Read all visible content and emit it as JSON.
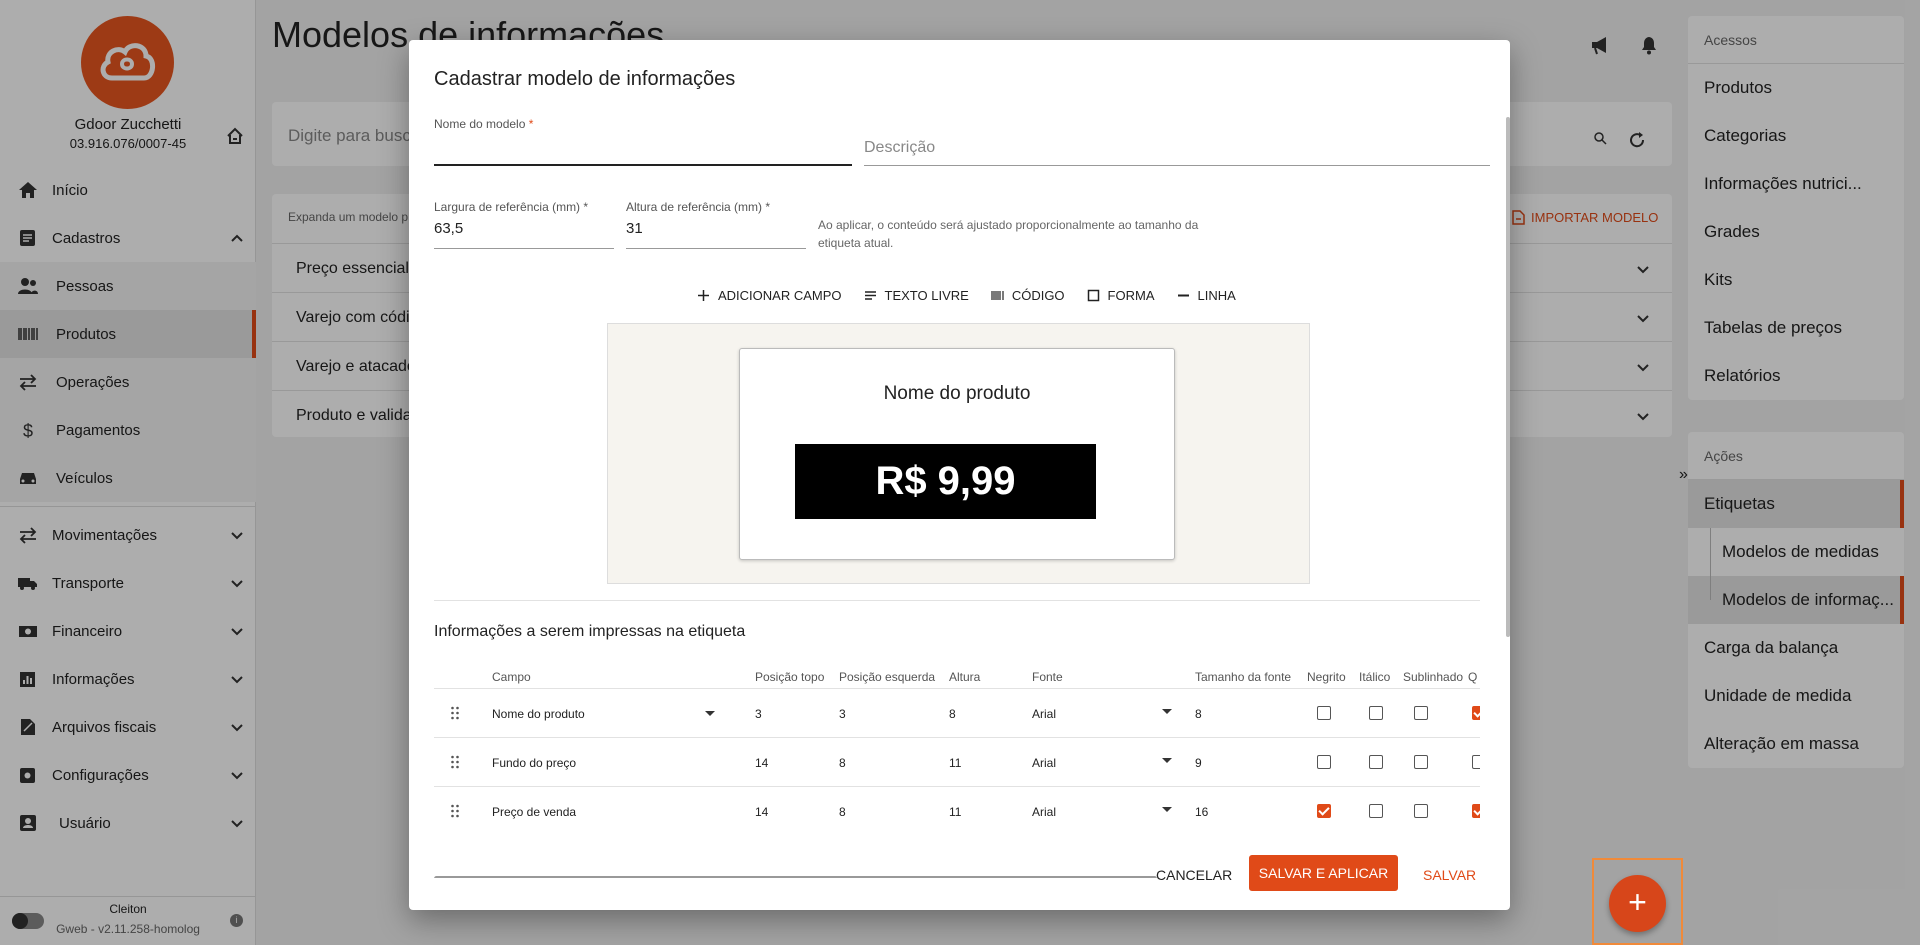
{
  "sidebar": {
    "user_name": "Gdoor Zucchetti",
    "user_cnpj": "03.916.076/0007-45",
    "items": [
      {
        "label": "Início",
        "icon": "home-icon"
      },
      {
        "label": "Cadastros",
        "icon": "document-icon",
        "expanded": true
      },
      {
        "label": "Pessoas",
        "icon": "people-icon"
      },
      {
        "label": "Produtos",
        "icon": "barcode-icon",
        "active": true
      },
      {
        "label": "Operações",
        "icon": "swap-icon"
      },
      {
        "label": "Pagamentos",
        "icon": "dollar-icon"
      },
      {
        "label": "Veículos",
        "icon": "car-icon"
      },
      {
        "label": "Movimentações",
        "icon": "swap-icon"
      },
      {
        "label": "Transporte",
        "icon": "truck-icon"
      },
      {
        "label": "Financeiro",
        "icon": "money-icon"
      },
      {
        "label": "Informações",
        "icon": "chart-icon"
      },
      {
        "label": "Arquivos fiscais",
        "icon": "file-icon"
      },
      {
        "label": "Configurações",
        "icon": "gear-icon"
      },
      {
        "label": "Usuário",
        "icon": "user-icon"
      }
    ],
    "footer_user": "Cleiton",
    "footer_version": "Gweb - v2.11.258-homolog"
  },
  "main": {
    "title": "Modelos de informações",
    "search_placeholder": "Digite para busc",
    "list_hint": "Expanda um modelo p",
    "import_label": "IMPORTAR MODELO",
    "rows": [
      "Preço essencial",
      "Varejo com códig",
      "Varejo e atacado",
      "Produto e valida"
    ]
  },
  "right_panel": {
    "access_title": "Acessos",
    "access_items": [
      "Produtos",
      "Categorias",
      "Informações nutrici...",
      "Grades",
      "Kits",
      "Tabelas de preços",
      "Relatórios"
    ],
    "actions_title": "Ações",
    "action_items": [
      "Etiquetas",
      "Modelos de medidas",
      "Modelos de informaç...",
      "Carga da balança",
      "Unidade de medida",
      "Alteração em massa"
    ],
    "collapse_glyph": "»"
  },
  "dialog": {
    "title": "Cadastrar modelo de informações",
    "name_label": "Nome do modelo",
    "name_value": "",
    "description_placeholder": "Descrição",
    "width_label": "Largura de referência (mm)",
    "width_value": "63,5",
    "height_label": "Altura de referência (mm)",
    "height_value": "31",
    "required_mark": "*",
    "hint": "Ao aplicar, o conteúdo será ajustado proporcionalmente ao tamanho da etiqueta atual.",
    "toolbar": [
      "ADICIONAR CAMPO",
      "TEXTO LIVRE",
      "CÓDIGO",
      "FORMA",
      "LINHA"
    ],
    "preview": {
      "product_name": "Nome do produto",
      "price": "R$ 9,99"
    },
    "section_title": "Informações a serem impressas na etiqueta",
    "columns": [
      "Campo",
      "Posição topo",
      "Posição esquerda",
      "Altura",
      "Fonte",
      "Tamanho da fonte",
      "Negrito",
      "Itálico",
      "Sublinhado",
      "Q"
    ],
    "rows": [
      {
        "campo": "Nome do produto",
        "topo": "3",
        "esquerda": "3",
        "altura": "8",
        "fonte": "Arial",
        "tamanho": "8",
        "negrito": false,
        "italico": false,
        "sublinhado": false,
        "q": true
      },
      {
        "campo": "Fundo do preço",
        "topo": "14",
        "esquerda": "8",
        "altura": "11",
        "fonte": "Arial",
        "tamanho": "9",
        "negrito": false,
        "italico": false,
        "sublinhado": false,
        "q": false
      },
      {
        "campo": "Preço de venda",
        "topo": "14",
        "esquerda": "8",
        "altura": "11",
        "fonte": "Arial",
        "tamanho": "16",
        "negrito": true,
        "italico": false,
        "sublinhado": false,
        "q": true
      }
    ],
    "cancel_label": "CANCELAR",
    "save_apply_label": "SALVAR E APLICAR",
    "save_label": "SALVAR"
  },
  "fab": {
    "label": "+"
  },
  "colors": {
    "accent": "#e04a18",
    "logo": "#e8561f"
  }
}
